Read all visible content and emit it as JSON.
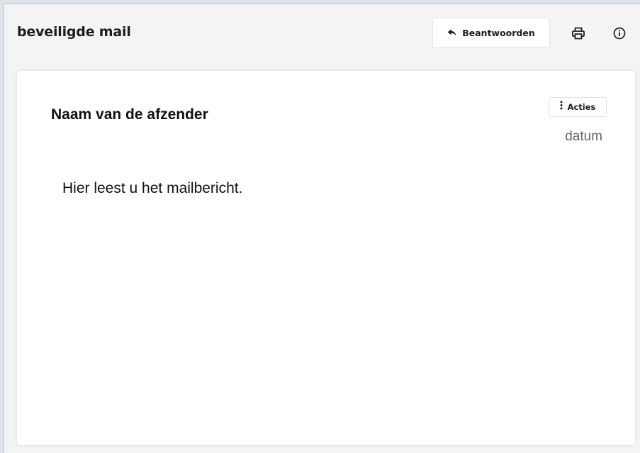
{
  "header": {
    "title": "beveiligde mail",
    "reply_label": "Beantwoorden",
    "reply_icon": "reply-icon",
    "print_icon": "print-icon",
    "info_icon": "info-icon"
  },
  "message": {
    "sender": "Naam van de afzender",
    "actions_label": "Acties",
    "actions_icon": "vertical-dots-icon",
    "date": "datum",
    "body": "Hier leest u het mailbericht."
  },
  "colors": {
    "background": "#f4f4f4",
    "card": "#ffffff",
    "text": "#111111",
    "muted_text": "#666666",
    "frame_border": "#c9d3e3"
  }
}
